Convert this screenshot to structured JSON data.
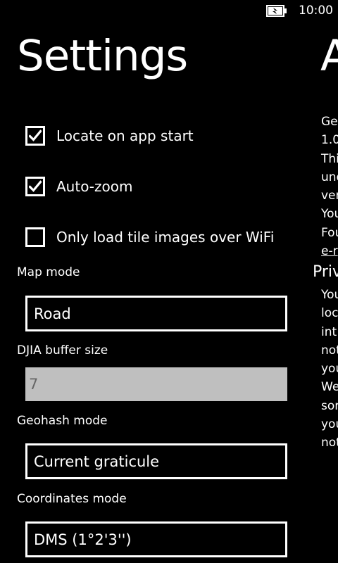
{
  "status_bar": {
    "battery_icon": "battery-charging-icon",
    "time": "10:00"
  },
  "settings": {
    "title": "Settings",
    "checkboxes": [
      {
        "label": "Locate on app start",
        "checked": true
      },
      {
        "label": "Auto-zoom",
        "checked": true
      },
      {
        "label": "Only load tile images over WiFi",
        "checked": false
      }
    ],
    "map_mode": {
      "label": "Map mode",
      "value": "Road"
    },
    "djia_buffer": {
      "label": "DJIA buffer size",
      "value": "7"
    },
    "geohash_mode": {
      "label": "Geohash mode",
      "value": "Current graticule"
    },
    "coordinates_mode": {
      "label": "Coordinates mode",
      "value": "DMS (1°2'3'')"
    }
  },
  "about": {
    "title": "A",
    "lines": [
      "Ge",
      "1.0",
      "Thi",
      "und",
      "ver",
      "You",
      "Fou"
    ],
    "link": "e-r",
    "privacy_heading": "Priv",
    "privacy_lines": [
      "You",
      "loc",
      "int",
      "not",
      "you",
      "We",
      "sor",
      "you",
      "not"
    ]
  },
  "colors": {
    "background": "#000000",
    "foreground": "#FFFFFF",
    "disabled_box": "#BFBFBF",
    "disabled_text": "#666666"
  }
}
